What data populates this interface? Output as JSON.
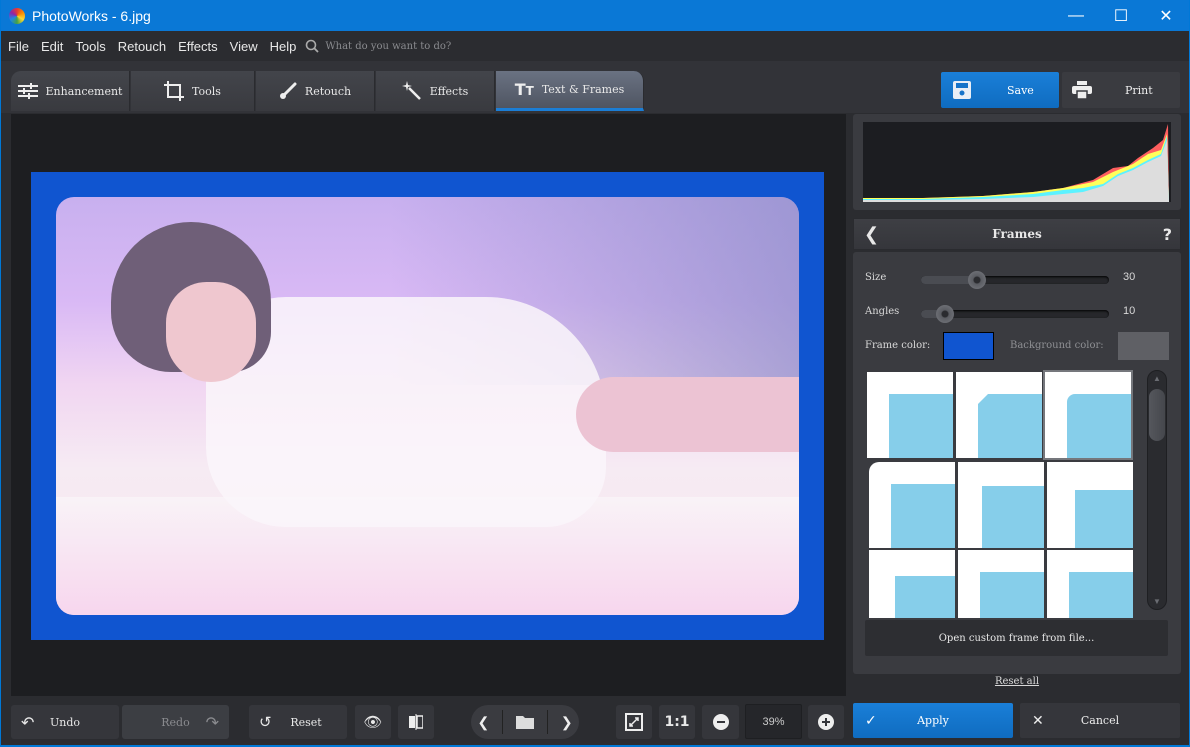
{
  "window": {
    "title": "PhotoWorks - 6.jpg",
    "controls": [
      "minimize",
      "maximize",
      "close"
    ]
  },
  "menu": {
    "items": [
      "File",
      "Edit",
      "Tools",
      "Retouch",
      "Effects",
      "View",
      "Help"
    ],
    "search_placeholder": "What do you want to do?"
  },
  "tabs": [
    {
      "label": "Enhancement",
      "icon": "sliders-icon"
    },
    {
      "label": "Tools",
      "icon": "crop-icon"
    },
    {
      "label": "Retouch",
      "icon": "brush-icon"
    },
    {
      "label": "Effects",
      "icon": "magic-wand-icon"
    },
    {
      "label": "Text & Frames",
      "icon": "text-icon",
      "active": true
    }
  ],
  "toolbar": {
    "save_label": "Save",
    "print_label": "Print"
  },
  "canvas": {
    "frame_color": "#1055d0"
  },
  "frames_panel": {
    "title": "Frames",
    "help": "?",
    "size_label": "Size",
    "size_value": "30",
    "size_fraction": 0.3,
    "angles_label": "Angles",
    "angles_value": "10",
    "angles_fraction": 0.13,
    "frame_color_label": "Frame color:",
    "frame_color": "#1055d0",
    "background_color_label": "Background color:",
    "background_color": "#5f6065",
    "thumbnails": [
      "square",
      "cut-corner",
      "rounded",
      "rounded-thick",
      "scallop-small",
      "scallop-large",
      "stamp-round",
      "zigzag",
      "zigzag-wave"
    ],
    "selected_thumbnail": 2,
    "open_custom_label": "Open custom frame from file...",
    "reset_all_label": "Reset all"
  },
  "bottom": {
    "undo_label": "Undo",
    "redo_label": "Redo",
    "reset_label": "Reset",
    "one_to_one": "1:1",
    "zoom_value": "39%",
    "apply_label": "Apply",
    "cancel_label": "Cancel"
  }
}
